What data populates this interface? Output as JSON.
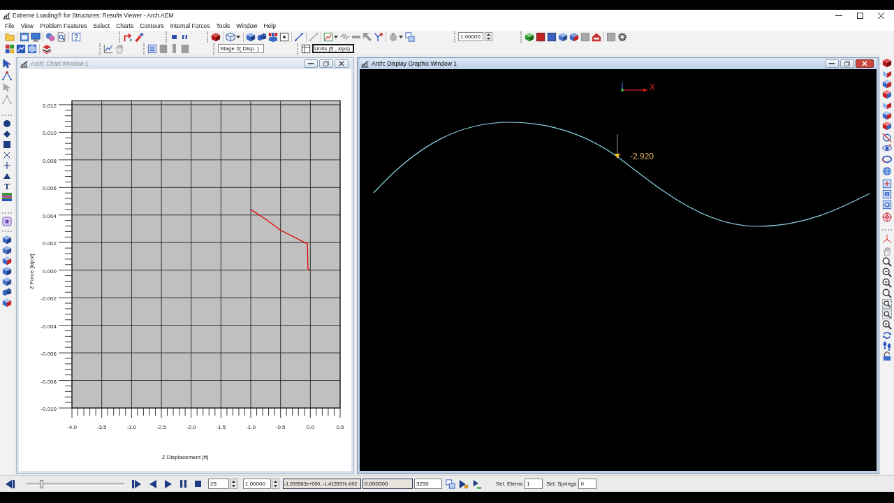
{
  "window": {
    "title": "Extreme Loading® for Structures: Results Viewer - Arch.AEM"
  },
  "menu": [
    "File",
    "View",
    "Problem Features",
    "Select",
    "Charts",
    "Contours",
    "Internal Forces",
    "Tools",
    "Window",
    "Help"
  ],
  "toolbar": {
    "scale_field": "1.00000",
    "stage_field": "Stage 2( Disp. )",
    "units_field": {
      "value": "Units (ft , kips)",
      "focused": true
    }
  },
  "left_toolbar": {
    "text_tool": "T"
  },
  "chart_window": {
    "title": "Arch: Chart Window 1",
    "active": false,
    "chart_data": {
      "type": "line",
      "xlabel": "Z Displacement [ft]",
      "ylabel": "Z Force [kipsf]",
      "xlim": [
        -4,
        0.5
      ],
      "ylim": [
        -0.01,
        0.0123
      ],
      "xticks": [
        {
          "value": -4,
          "label": "-4.0"
        },
        {
          "value": -3.5,
          "label": "-3.5"
        },
        {
          "value": -3,
          "label": "-3.0"
        },
        {
          "value": -2.5,
          "label": "-2.5"
        },
        {
          "value": -2,
          "label": "-2.0"
        },
        {
          "value": -1.5,
          "label": "-1.5"
        },
        {
          "value": -1,
          "label": "-1.0"
        },
        {
          "value": -0.5,
          "label": "-0.5"
        },
        {
          "value": 0,
          "label": "0.0"
        },
        {
          "value": 0.5,
          "label": "0.5"
        }
      ],
      "yticks": [
        {
          "value": 0.012,
          "label": "0.012"
        },
        {
          "value": 0.01,
          "label": "0.010"
        },
        {
          "value": 0.008,
          "label": "0.008"
        },
        {
          "value": 0.006,
          "label": "0.006"
        },
        {
          "value": 0.004,
          "label": "0.004"
        },
        {
          "value": 0.002,
          "label": "0.002"
        },
        {
          "value": 0,
          "label": "0.000"
        },
        {
          "value": -0.002,
          "label": "-0.002"
        },
        {
          "value": -0.004,
          "label": "-0.004"
        },
        {
          "value": -0.006,
          "label": "-0.006"
        },
        {
          "value": -0.008,
          "label": "-0.008"
        },
        {
          "value": -0.01,
          "label": "-0.010"
        }
      ],
      "grid": true,
      "x": [
        -1.0,
        -0.75,
        -0.5,
        -0.05,
        -0.04,
        0.0
      ],
      "values": [
        0.0044,
        0.0037,
        0.0029,
        0.0019,
        0.0001,
        0.0
      ],
      "color": "#e00000"
    }
  },
  "display_window": {
    "title": "Arch: Display Graphic Window 1",
    "active": true,
    "axis_label": "X",
    "annotation": "-2.920"
  },
  "player": {
    "slider": {
      "level": 0.16
    },
    "counter_field": "25",
    "factor_field": "1.00000",
    "coordinates_field": "-1.539583e+000, -1.415597e-002",
    "value_field": "0.000000",
    "number_field": "3250",
    "selected_elements": {
      "label": "Sel. Elems",
      "value": "1"
    },
    "selected_springs": {
      "label": "Sel. Springs",
      "value": "0"
    }
  }
}
